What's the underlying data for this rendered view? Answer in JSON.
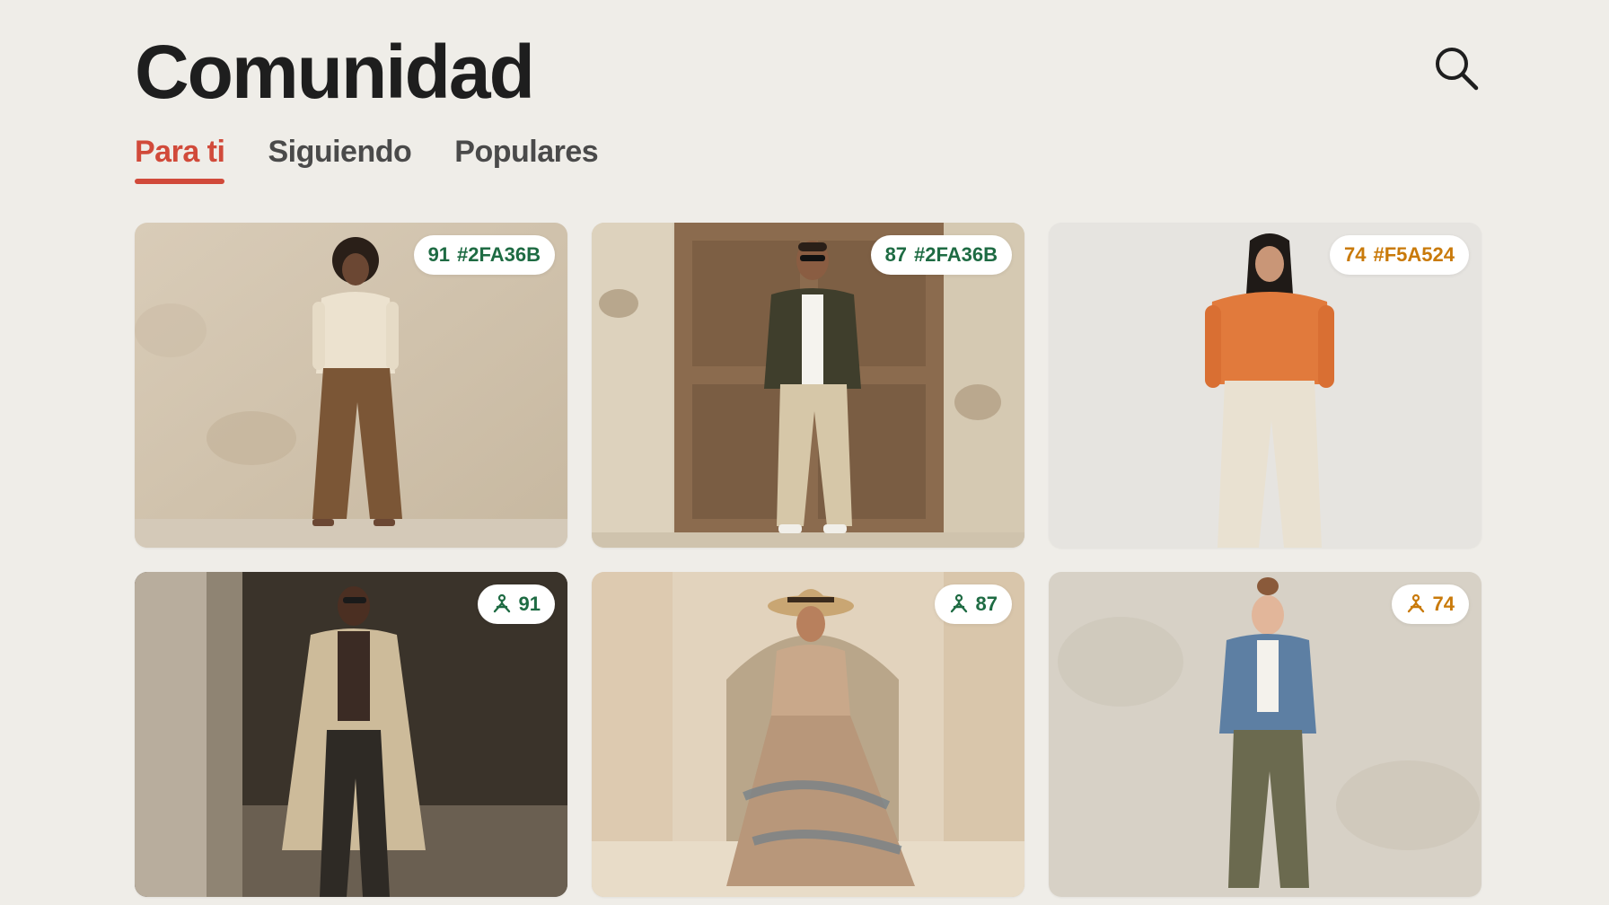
{
  "header": {
    "title": "Comunidad",
    "search_icon": "search-icon"
  },
  "tabs": [
    {
      "label": "Para ti",
      "active": true
    },
    {
      "label": "Siguiendo",
      "active": false
    },
    {
      "label": "Populares",
      "active": false
    }
  ],
  "colors": {
    "accent": "#d14a3a",
    "score_green": "#2FA36B",
    "score_orange": "#F5A524",
    "background": "#efede8"
  },
  "posts": [
    {
      "score": "91",
      "color_code": "#2FA36B",
      "badge_type": "score-color",
      "badge_color": "#1e6b43",
      "photo": "woman in cream cardigan and brown wide-leg trousers"
    },
    {
      "score": "87",
      "color_code": "#2FA36B",
      "badge_type": "score-color",
      "badge_color": "#1e6b43",
      "photo": "man in olive jacket and beige chinos by wooden door"
    },
    {
      "score": "74",
      "color_code": "#F5A524",
      "badge_type": "score-color",
      "badge_color": "#c97a0a",
      "photo": "woman in orange sweater and cream trousers"
    },
    {
      "score": "91",
      "icon": "hanger-icon",
      "badge_type": "score-icon",
      "badge_color": "#1e6b43",
      "photo": "man in beige trench coat"
    },
    {
      "score": "87",
      "icon": "hanger-icon",
      "badge_type": "score-icon",
      "badge_color": "#1e6b43",
      "photo": "woman in patterned maxi dress and straw hat"
    },
    {
      "score": "74",
      "icon": "hanger-icon",
      "badge_type": "score-icon",
      "badge_color": "#c97a0a",
      "photo": "woman in denim jacket and olive joggers"
    }
  ]
}
